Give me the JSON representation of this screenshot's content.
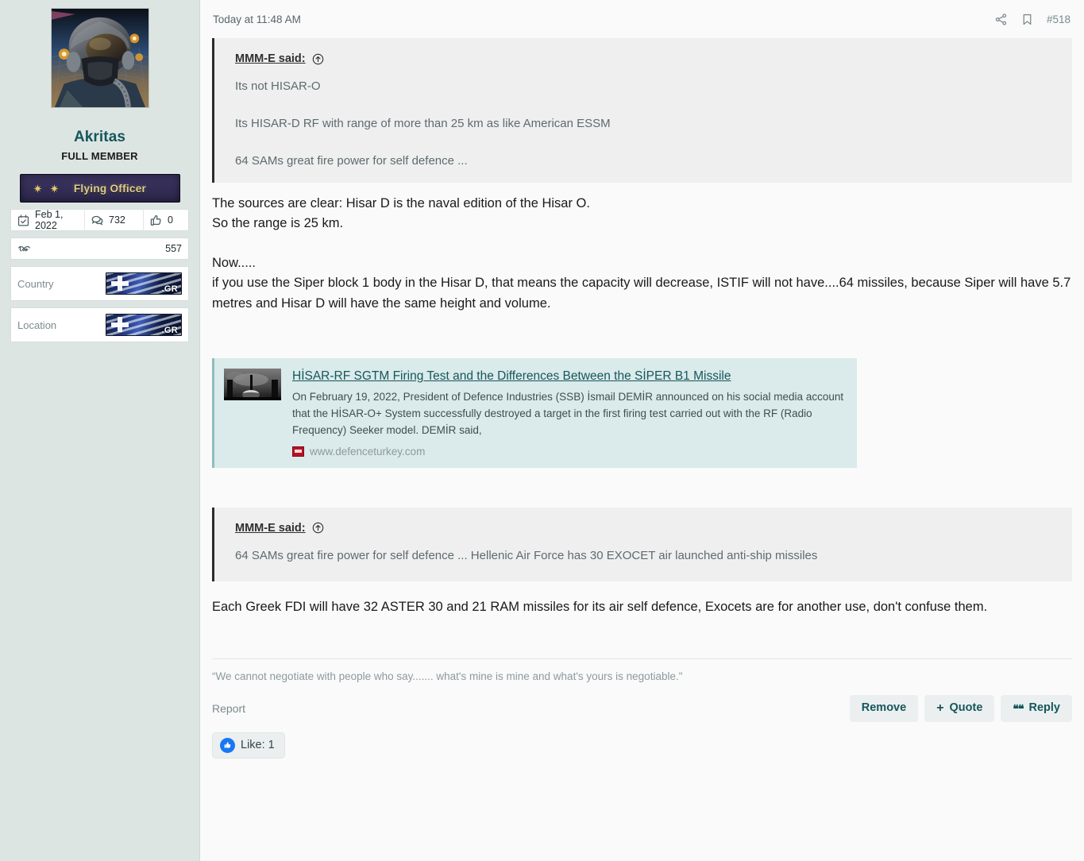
{
  "sidebar": {
    "avatar_alt": "fighter-pilot-helmet-avatar",
    "username": "Akritas",
    "user_title": "FULL MEMBER",
    "rank": {
      "label": "Flying Officer",
      "stars": 2,
      "bg_color": "#332d55",
      "text_color": "#e0cf8e"
    },
    "stats": {
      "joined_label": "Feb 1, 2022",
      "messages": "732",
      "likes": "0",
      "reactions": "557"
    },
    "fields": [
      {
        "label": "Country",
        "value_badge": "GR",
        "tld": ".GR"
      },
      {
        "label": "Location",
        "value_badge": "GR",
        "tld": ".GR"
      }
    ]
  },
  "post": {
    "date": "Today at 11:48 AM",
    "share_icon": "share-icon",
    "bookmark_icon": "bookmark-icon",
    "number": "#518",
    "quote1": {
      "author": "MMM-E said:",
      "jump_icon": "jump-to-post-icon",
      "lines": [
        "Its not HISAR-O",
        "Its HISAR-D RF with range of more than 25 km as like American ESSM",
        "64 SAMs great fire power for self defence ..."
      ]
    },
    "body1": [
      "The sources are clear: Hisar D is the naval edition of the Hisar O.",
      "So the range is 25 km.",
      "Now.....",
      "if you use the Siper block 1 body in the Hisar D, that means the capacity will decrease, ISTIF will not have....64 missiles, because Siper will have 5.7 metres and Hisar D will have the same height and volume."
    ],
    "link_preview": {
      "title": "HİSAR-RF SGTM Firing Test and the Differences Between the SİPER B1 Missile",
      "description": "On February 19, 2022, President of Defence Industries (SSB) İsmail DEMİR announced on his social media account that the HİSAR-O+ System successfully destroyed a target in the first firing test carried out with the RF (Radio Frequency) Seeker model. DEMİR said,",
      "host": "www.defenceturkey.com",
      "thumb_alt": "missile-launch-thumbnail"
    },
    "quote2": {
      "author": "MMM-E said:",
      "jump_icon": "jump-to-post-icon",
      "lines": [
        "64 SAMs great fire power for self defence ... Hellenic Air Force has 30 EXOCET air launched anti-ship missiles"
      ]
    },
    "body2": [
      "Each Greek FDI will have 32 ASTER 30 and 21 RAM missiles for its air self defence, Exocets are for another use, don't confuse them."
    ],
    "signature": "“We cannot negotiate with people who say....... what's mine is mine and what's yours is negotiable.\"",
    "footer": {
      "report_label": "Report",
      "remove_label": "Remove",
      "quote_label": "Quote",
      "quote_plus": "+",
      "reply_label": "Reply",
      "reply_glyph": "❝❝"
    },
    "reactions": {
      "label": "Like: 1",
      "icon": "thumbs-up-icon",
      "icon_color": "#1877f2"
    }
  }
}
